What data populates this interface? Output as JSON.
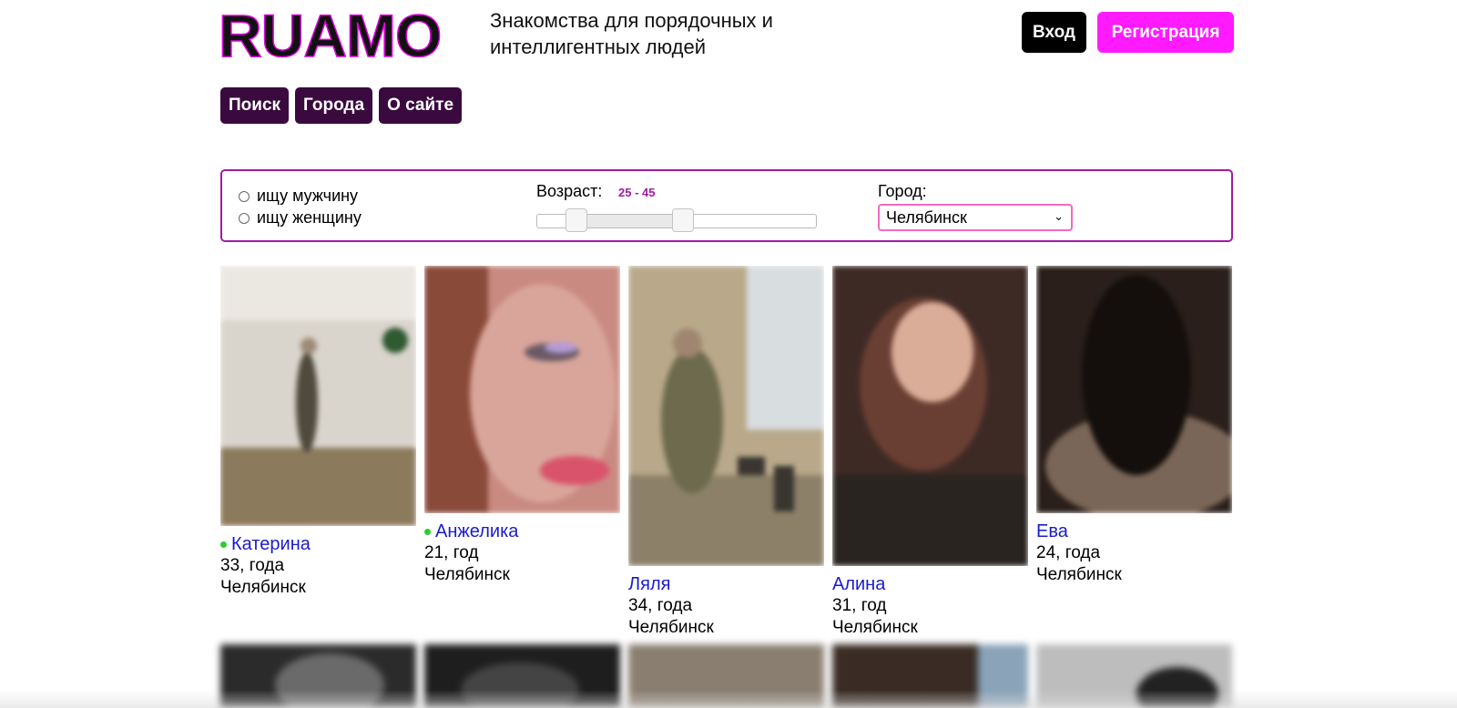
{
  "header": {
    "logo": "RUAMO",
    "tagline": "Знакомства для порядочных и интеллигентных людей",
    "login_label": "Вход",
    "register_label": "Регистрация",
    "accent_color": "#ff1aff"
  },
  "nav": {
    "items": [
      {
        "label": "Поиск"
      },
      {
        "label": "Города"
      },
      {
        "label": "О сайте"
      }
    ],
    "color": "#3a0a3f"
  },
  "filter": {
    "seek_male": "ищу мужчину",
    "seek_female": "ищу женщину",
    "age_label": "Возраст:",
    "age_range": "25 - 45",
    "age_min": 25,
    "age_max": 45,
    "city_label": "Город:",
    "city_selected": "Челябинск"
  },
  "profiles": [
    {
      "name": "Катерина",
      "age": "33, года",
      "city": "Челябинск",
      "online": true
    },
    {
      "name": "Анжелика",
      "age": "21, год",
      "city": "Челябинск",
      "online": true
    },
    {
      "name": "Ляля",
      "age": "34, года",
      "city": "Челябинск",
      "online": false
    },
    {
      "name": "Алина",
      "age": "31, год",
      "city": "Челябинск",
      "online": false
    },
    {
      "name": "Ева",
      "age": "24, года",
      "city": "Челябинск",
      "online": false
    }
  ]
}
